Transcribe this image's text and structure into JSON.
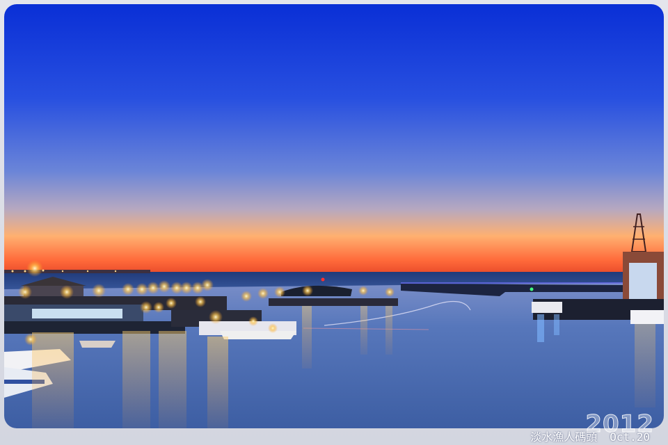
{
  "photo": {
    "subject": "harbor-at-dusk",
    "colors": {
      "sky_top": "#0a32d8",
      "sky_mid": "#4f73e0",
      "horizon_glow": "#ff6a3a",
      "water": "#4d70b0",
      "light_reflection": "#f2b040"
    }
  },
  "watermark": {
    "year": "2012"
  },
  "caption": {
    "place": "淡水漁人碼頭",
    "date": "Oct.20"
  }
}
